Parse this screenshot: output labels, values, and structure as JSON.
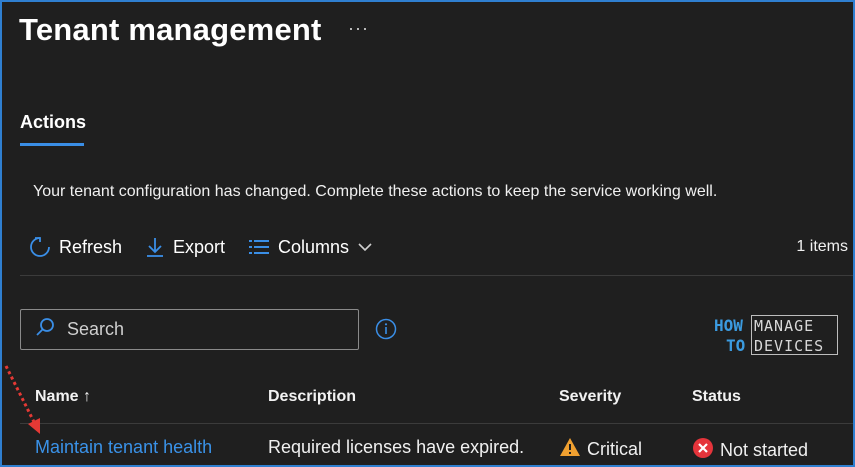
{
  "header": {
    "title": "Tenant management",
    "more_label": "···"
  },
  "tabs": [
    {
      "label": "Actions",
      "active": true
    }
  ],
  "description": "Your tenant configuration has changed. Complete these actions to keep the service working well.",
  "toolbar": {
    "refresh_label": "Refresh",
    "export_label": "Export",
    "columns_label": "Columns",
    "items_count": "1 items"
  },
  "search": {
    "placeholder": "Search",
    "value": ""
  },
  "logo": {
    "how": "HOW",
    "to": "TO",
    "manage": "MANAGE",
    "devices": "DEVICES"
  },
  "table": {
    "columns": [
      "Name ↑",
      "Description",
      "Severity",
      "Status"
    ],
    "rows": [
      {
        "name": "Maintain tenant health",
        "description": "Required licenses have expired.",
        "severity": "Critical",
        "status": "Not started"
      }
    ]
  },
  "colors": {
    "accent": "#3a8ee6",
    "link": "#3a92e8",
    "warning": "#f0a030",
    "error": "#e5343b",
    "annotation": "#e53935"
  }
}
